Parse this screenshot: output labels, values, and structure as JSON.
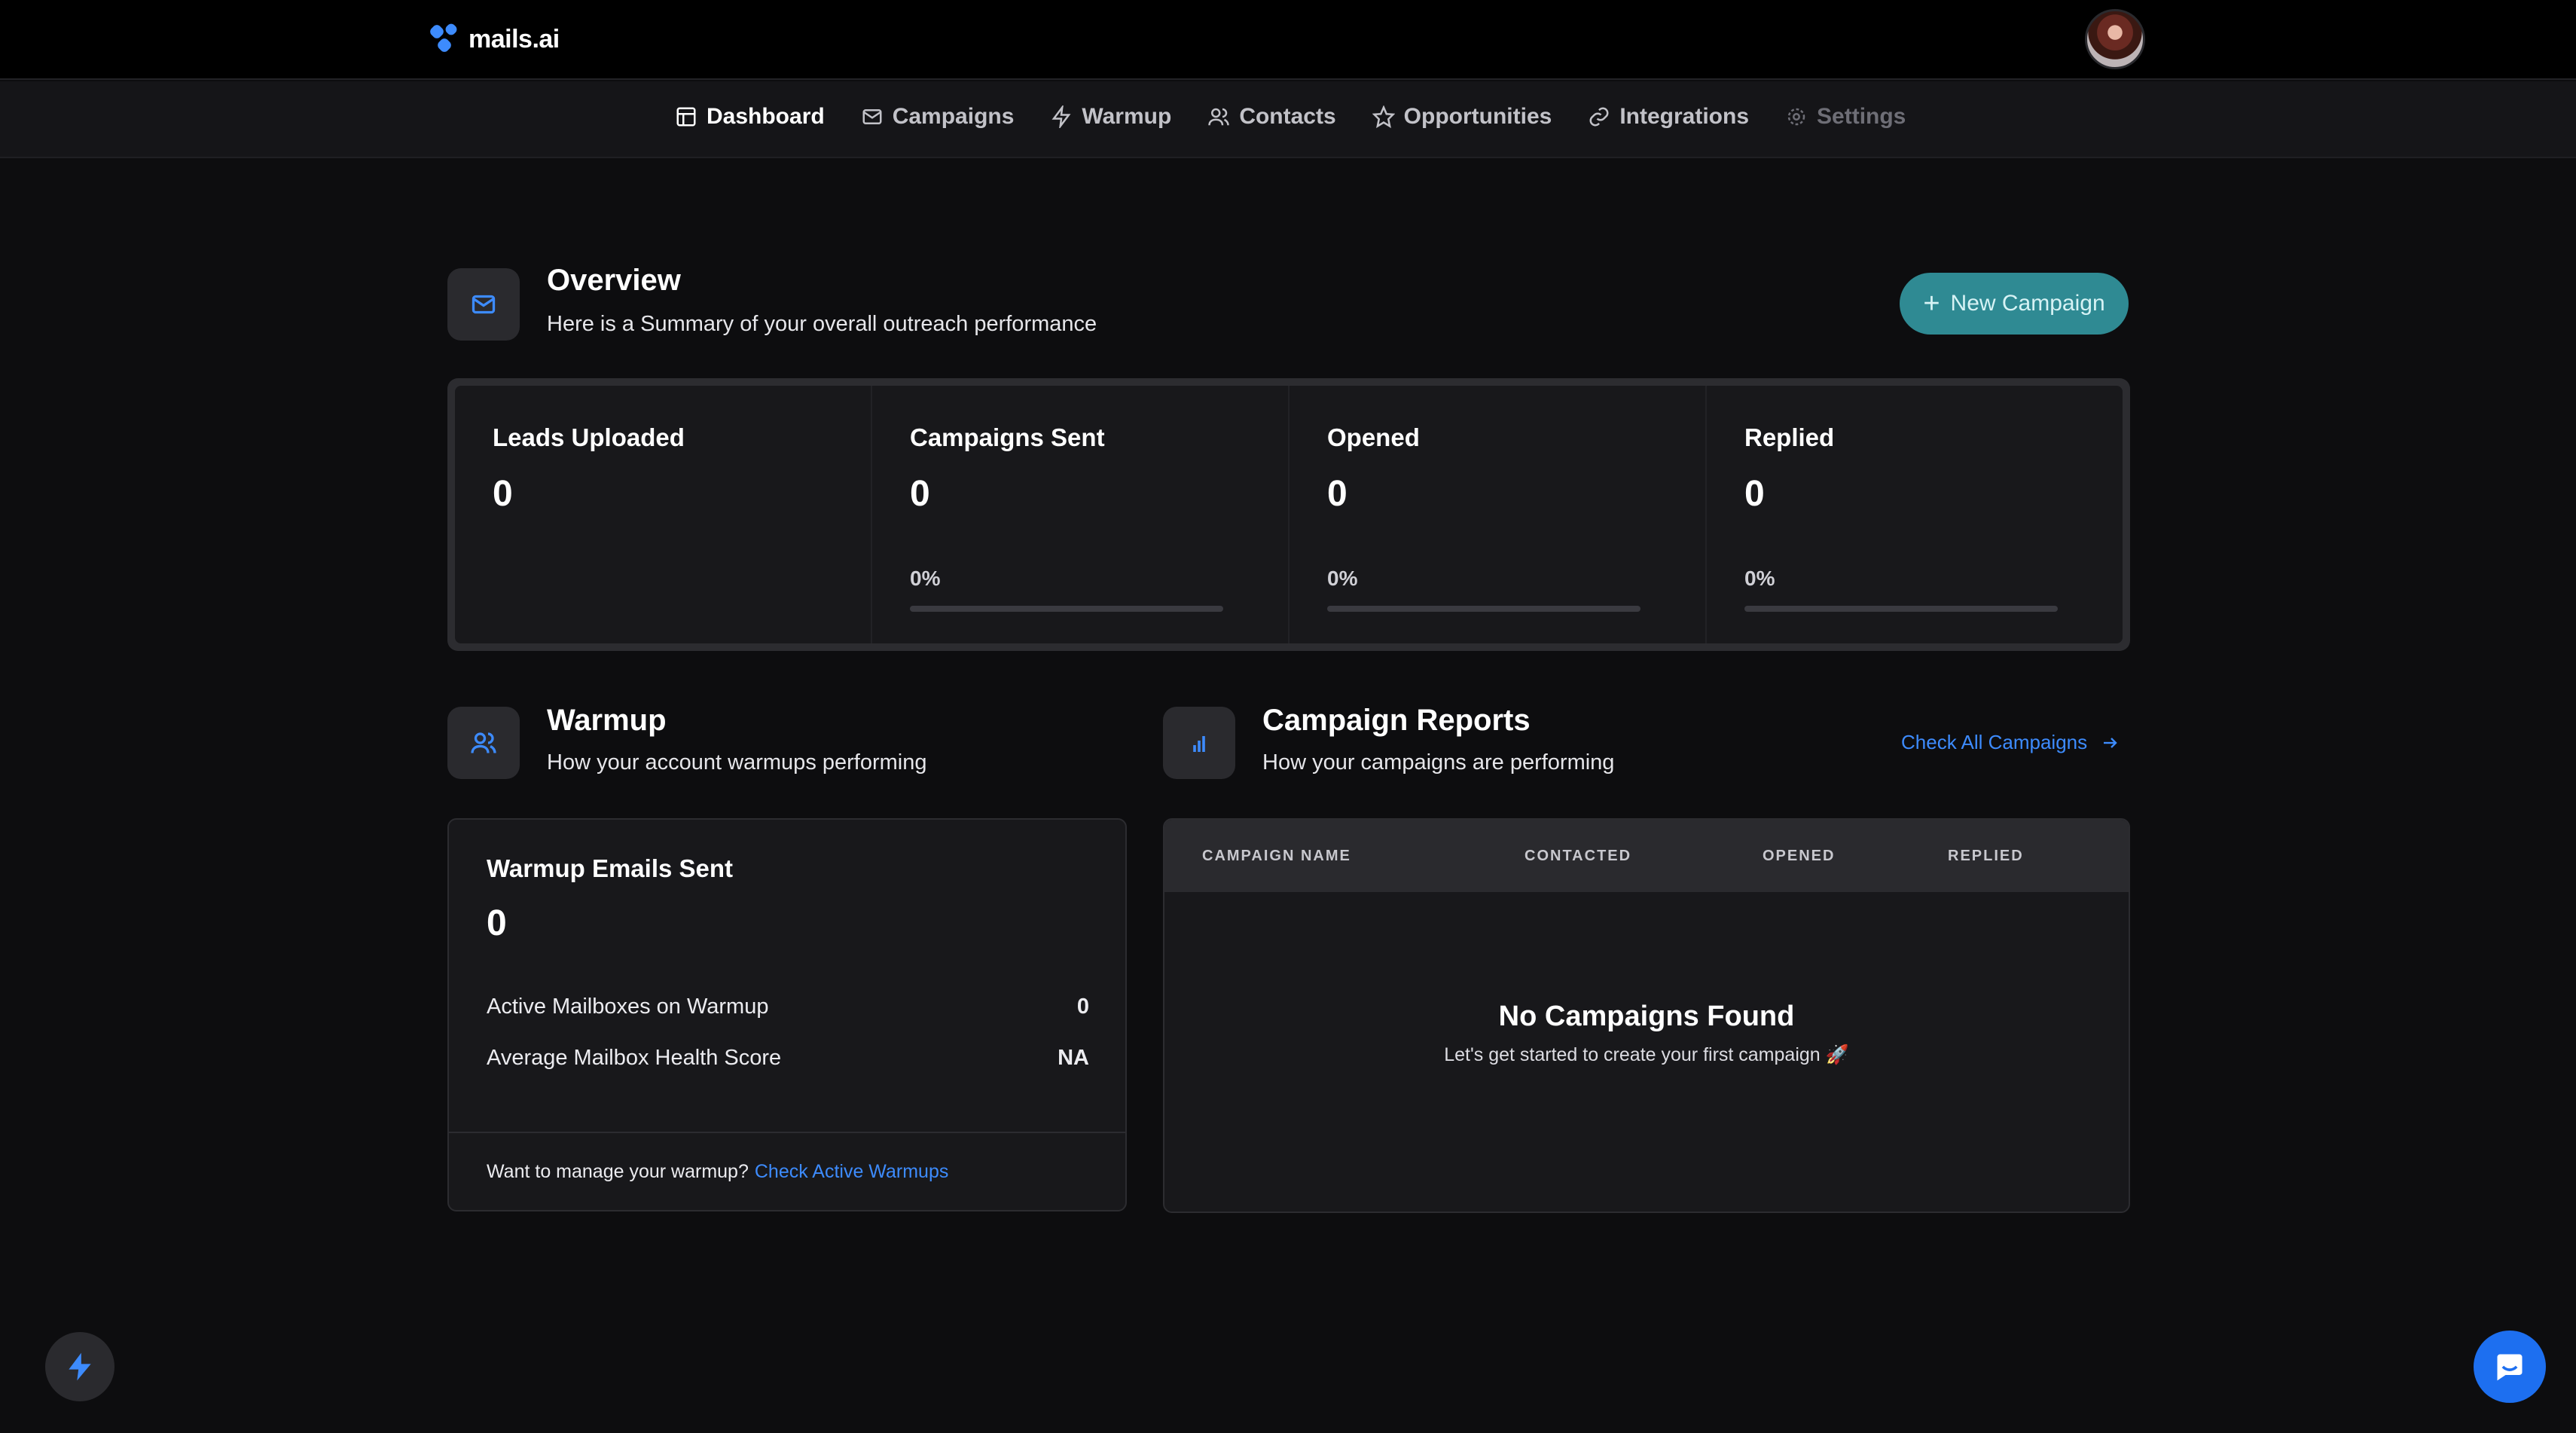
{
  "brand": {
    "name": "mails.ai",
    "accent": "#3d8bfd"
  },
  "nav": [
    {
      "label": "Dashboard",
      "icon": "layout-icon",
      "state": "active"
    },
    {
      "label": "Campaigns",
      "icon": "mail-icon",
      "state": "normal"
    },
    {
      "label": "Warmup",
      "icon": "bolt-icon",
      "state": "normal"
    },
    {
      "label": "Contacts",
      "icon": "users-icon",
      "state": "normal"
    },
    {
      "label": "Opportunities",
      "icon": "star-icon",
      "state": "normal"
    },
    {
      "label": "Integrations",
      "icon": "link-icon",
      "state": "normal"
    },
    {
      "label": "Settings",
      "icon": "gear-icon",
      "state": "disabled"
    }
  ],
  "overview": {
    "title": "Overview",
    "subtitle": "Here is a Summary of your overall outreach performance",
    "new_campaign_label": "New Campaign",
    "stats": [
      {
        "label": "Leads Uploaded",
        "value": "0"
      },
      {
        "label": "Campaigns Sent",
        "value": "0",
        "percent": "0%",
        "progress": 0
      },
      {
        "label": "Opened",
        "value": "0",
        "percent": "0%",
        "progress": 0
      },
      {
        "label": "Replied",
        "value": "0",
        "percent": "0%",
        "progress": 0
      }
    ]
  },
  "warmup": {
    "title": "Warmup",
    "subtitle": "How your account warmups performing",
    "card_title": "Warmup Emails Sent",
    "card_value": "0",
    "rows": [
      {
        "label": "Active Mailboxes on Warmup",
        "value": "0"
      },
      {
        "label": "Average Mailbox Health Score",
        "value": "NA"
      }
    ],
    "footer_text": "Want to manage your warmup?",
    "footer_link": "Check Active Warmups"
  },
  "reports": {
    "title": "Campaign Reports",
    "subtitle": "How your campaigns are performing",
    "check_all": "Check All Campaigns",
    "columns": [
      "CAMPAIGN NAME",
      "CONTACTED",
      "OPENED",
      "REPLIED"
    ],
    "empty_title": "No Campaigns Found",
    "empty_subtitle": "Let's get started to create your first campaign 🚀"
  },
  "colors": {
    "background": "#0d0d0f",
    "teal": "#2f8a93",
    "link": "#3d8bfd",
    "chat": "#1d6ff0"
  }
}
